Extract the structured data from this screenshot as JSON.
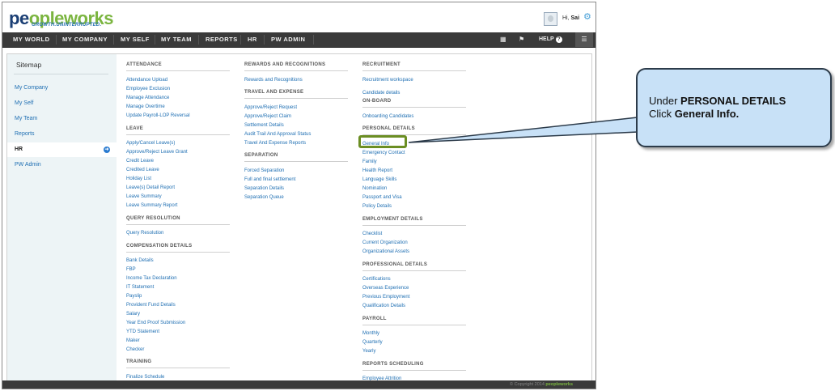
{
  "header": {
    "logo_part1": "pe",
    "logo_part2": "ople",
    "logo_part3": "works",
    "tagline": "GROWTH.UNINTERRUPTED.",
    "greeting": "Hi,",
    "user": "Sai",
    "settings_icon": "gear-icon"
  },
  "nav": {
    "items": [
      "MY WORLD",
      "MY COMPANY",
      "MY SELF",
      "MY TEAM",
      "REPORTS",
      "HR",
      "PW ADMIN"
    ],
    "help_label": "HELP",
    "help_symbol": "?",
    "icons": [
      "grid-icon",
      "flag-icon",
      "menu-icon"
    ]
  },
  "sidebar": {
    "title": "Sitemap",
    "items": [
      "My Company",
      "My Self",
      "My Team",
      "Reports",
      "HR",
      "PW Admin"
    ],
    "active": "HR"
  },
  "sitemap": {
    "col1": {
      "attendance": {
        "title": "ATTENDANCE",
        "links": [
          "Attendance Upload",
          "Employee Exclusion",
          "Manage Attendance",
          "Manage Overtime",
          "Update Payroll-LOP Reversal"
        ]
      },
      "leave": {
        "title": "LEAVE",
        "links": [
          "Apply/Cancel Leave(s)",
          "Approve/Reject Leave Grant",
          "Credit Leave",
          "Credited Leave",
          "Holiday List",
          "Leave(s) Detail Report",
          "Leave Summary",
          "Leave Summary Report"
        ]
      },
      "query": {
        "title": "QUERY RESOLUTION",
        "links": [
          "Query Resolution"
        ]
      },
      "compensation": {
        "title": "COMPENSATION DETAILS",
        "links": [
          "Bank Details",
          "FBP",
          "Income Tax Declaration",
          "IT Statement",
          "Payslip",
          "Provident Fund Details",
          "Salary",
          "Year End Proof Submission",
          "YTD Statement",
          "Maker",
          "Checker"
        ]
      },
      "training": {
        "title": "TRAINING",
        "links": [
          "Finalize Schedule"
        ]
      }
    },
    "col2": {
      "rewards": {
        "title": "REWARDS AND RECOGNITIONS",
        "links": [
          "Rewards and Recognitions"
        ]
      },
      "travel": {
        "title": "TRAVEL AND EXPENSE",
        "links": [
          "Approve/Reject Request",
          "Approve/Reject Claim",
          "Settlement Details",
          "Audit Trail And Approval Status",
          "Travel And Expense Reports"
        ]
      },
      "separation": {
        "title": "SEPARATION",
        "links": [
          "Forced Separation",
          "Full and final settlement",
          "Separation Details",
          "Separation Queue"
        ]
      }
    },
    "col3": {
      "recruitment": {
        "title": "RECRUITMENT",
        "links": [
          "Recruitment workspace",
          "Candidate details"
        ]
      },
      "onboard": {
        "title": "ON-BOARD",
        "links": [
          "Onboarding Candidates"
        ]
      },
      "personal": {
        "title": "PERSONAL DETAILS",
        "links": [
          "General Info",
          "Emergency Contact",
          "Family",
          "Health Report",
          "Language Skills",
          "Nomination",
          "Passport and Visa",
          "Policy Details"
        ]
      },
      "employment": {
        "title": "EMPLOYMENT DETAILS",
        "links": [
          "Checklist",
          "Current Organization",
          "Organizational Assets"
        ]
      },
      "professional": {
        "title": "PROFESSIONAL DETAILS",
        "links": [
          "Certifications",
          "Overseas Experience",
          "Previous Employment",
          "Qualification Details"
        ]
      },
      "payroll": {
        "title": "PAYROLL",
        "links": [
          "Monthly",
          "Quarterly",
          "Yearly"
        ]
      },
      "reports": {
        "title": "REPORTS SCHEDULING",
        "links": [
          "Employee Attrition"
        ]
      }
    }
  },
  "footer": {
    "copyright": "© Copyright 2014",
    "brand": "peopleworks"
  },
  "callout": {
    "line1_prefix": "Under ",
    "line1_bold": "PERSONAL DETAILS",
    "line2_prefix": "Click ",
    "line2_bold": "General Info",
    "line2_suffix": "."
  },
  "colors": {
    "accent": "#1f6fb3",
    "nav_bg": "#3a3a3a",
    "highlight": "#6b8e23",
    "callout_bg": "#c8e1f7",
    "logo_green": "#7bb540"
  }
}
